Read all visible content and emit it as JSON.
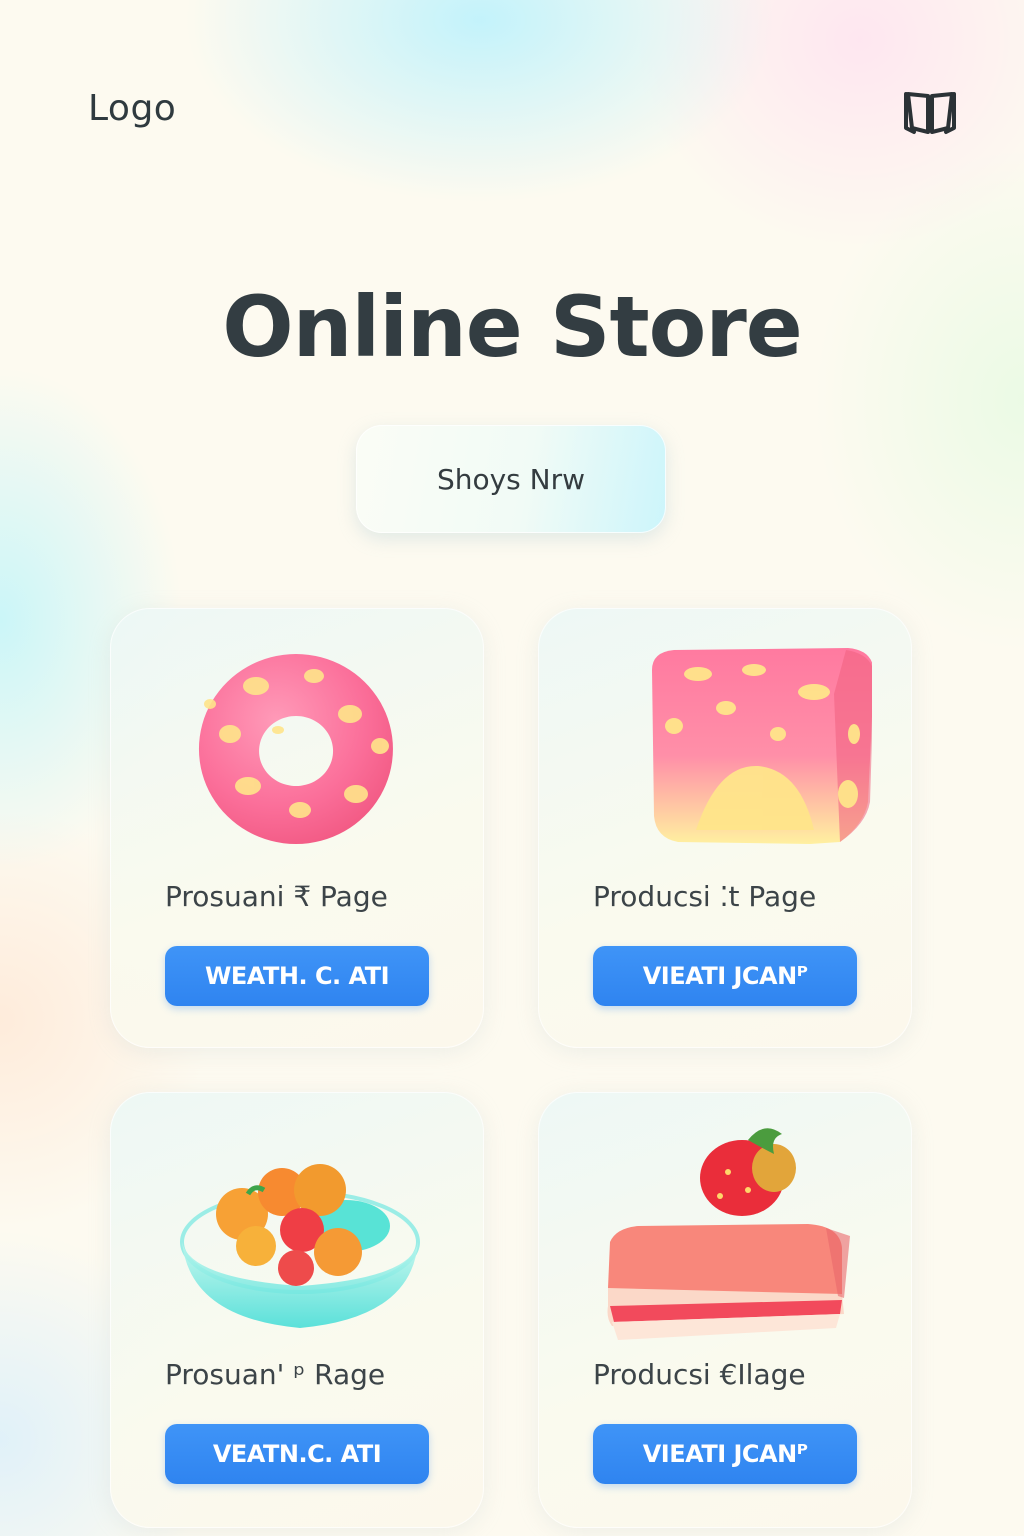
{
  "header": {
    "logo_text": "Logo",
    "menu_icon": "open-book-icon"
  },
  "hero": {
    "title": "Online Store",
    "cta_label": "Shoys Nrw"
  },
  "products": [
    {
      "title": "Prosuani ₹ Page",
      "button_label": "WEATH. C. ATI",
      "image": "pink-donut"
    },
    {
      "title": "Producsi ⁚t Page",
      "button_label": "VIEATI JCANᴾ",
      "image": "pink-cube"
    },
    {
      "title": "Prosuan' ᵖ Rage",
      "button_label": "VEATN.C. ATI",
      "image": "fruit-bowl"
    },
    {
      "title": "Producsi €Ilage",
      "button_label": "VIEATI JCANᴾ",
      "image": "strawberry-cake"
    }
  ],
  "colors": {
    "accent_blue": "#2f84f0",
    "text_dark": "#333d42",
    "background": "#fdfaf0"
  }
}
